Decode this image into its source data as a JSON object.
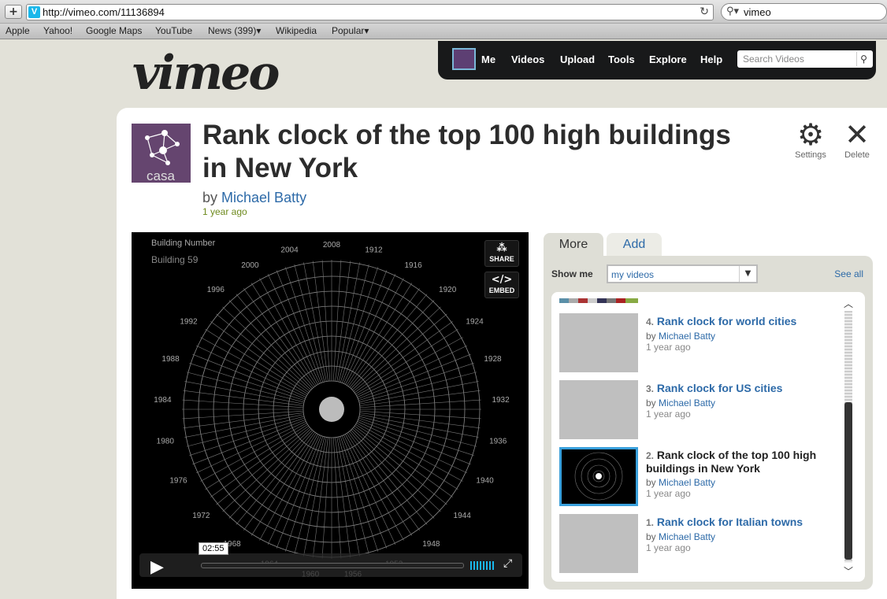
{
  "browser": {
    "url": "http://vimeo.com/11136894",
    "search": "vimeo",
    "bookmarks": [
      "Apple",
      "Yahoo!",
      "Google Maps",
      "YouTube",
      "News (399)",
      "Wikipedia",
      "Popular"
    ]
  },
  "site": {
    "logo": "vimeo",
    "nav": [
      "Me",
      "Videos",
      "Upload",
      "Tools",
      "Explore",
      "Help"
    ],
    "search_placeholder": "Search Videos"
  },
  "video": {
    "title": "Rank clock of the top 100 high buildings in New York",
    "by_prefix": "by",
    "author": "Michael Batty",
    "posted": "1 year ago",
    "tools": {
      "settings": "Settings",
      "delete": "Delete"
    },
    "player": {
      "overlay_label": "Building Number",
      "overlay_value": "Building 59",
      "share": "SHARE",
      "embed": "EMBED",
      "time": "02:55",
      "years": [
        "2008",
        "1912",
        "1916",
        "1920",
        "1924",
        "1928",
        "1932",
        "1936",
        "1940",
        "1944",
        "1948",
        "1952",
        "1956",
        "1960",
        "1964",
        "1968",
        "1972",
        "1976",
        "1980",
        "1984",
        "1988",
        "1992",
        "1996",
        "2000",
        "2004"
      ]
    }
  },
  "sidebar": {
    "tabs": [
      "More",
      "Add"
    ],
    "show_me_label": "Show me",
    "filter": "my videos",
    "see_all": "See all",
    "items": [
      {
        "num": "4.",
        "title": "Rank clock for world cities",
        "by": "by",
        "author": "Michael Batty",
        "ago": "1 year ago"
      },
      {
        "num": "3.",
        "title": "Rank clock for US cities",
        "by": "by",
        "author": "Michael Batty",
        "ago": "1 year ago"
      },
      {
        "num": "2.",
        "title": "Rank clock of the top 100 high buildings in New York",
        "by": "by",
        "author": "Michael Batty",
        "ago": "1 year ago"
      },
      {
        "num": "1.",
        "title": "Rank clock for Italian towns",
        "by": "by",
        "author": "Michael Batty",
        "ago": "1 year ago"
      }
    ]
  }
}
